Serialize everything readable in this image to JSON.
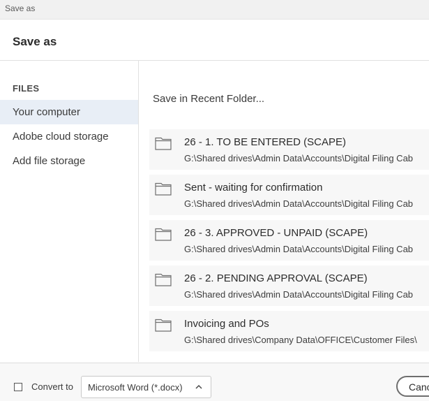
{
  "window": {
    "title": "Save as"
  },
  "dialog": {
    "title": "Save as"
  },
  "sidebar": {
    "heading": "FILES",
    "items": [
      {
        "label": "Your computer",
        "selected": true
      },
      {
        "label": "Adobe cloud storage",
        "selected": false
      },
      {
        "label": "Add file storage",
        "selected": false
      }
    ]
  },
  "content": {
    "recent_label": "Save in Recent Folder...",
    "folders": [
      {
        "name": "26 - 1. TO BE ENTERED (SCAPE)",
        "path": "G:\\Shared drives\\Admin Data\\Accounts\\Digital Filing Cab",
        "icon": "folder-icon"
      },
      {
        "name": "Sent - waiting for confirmation",
        "path": "G:\\Shared drives\\Admin Data\\Accounts\\Digital Filing Cab",
        "icon": "folder-icon"
      },
      {
        "name": "26 - 3. APPROVED - UNPAID (SCAPE)",
        "path": "G:\\Shared drives\\Admin Data\\Accounts\\Digital Filing Cab",
        "icon": "folder-icon"
      },
      {
        "name": "26 - 2. PENDING APPROVAL (SCAPE)",
        "path": "G:\\Shared drives\\Admin Data\\Accounts\\Digital Filing Cab",
        "icon": "folder-icon"
      },
      {
        "name": "Invoicing and POs",
        "path": "G:\\Shared drives\\Company Data\\OFFICE\\Customer Files\\",
        "icon": "folder-icon"
      }
    ]
  },
  "footer": {
    "convert_label": "Convert to",
    "convert_checked": false,
    "format_value": "Microsoft Word (*.docx)",
    "cancel_label": "Cancel"
  },
  "colors": {
    "selected_bg": "#e8eef6",
    "row_bg": "#f7f7f7",
    "footer_bg": "#f8f8f8"
  }
}
